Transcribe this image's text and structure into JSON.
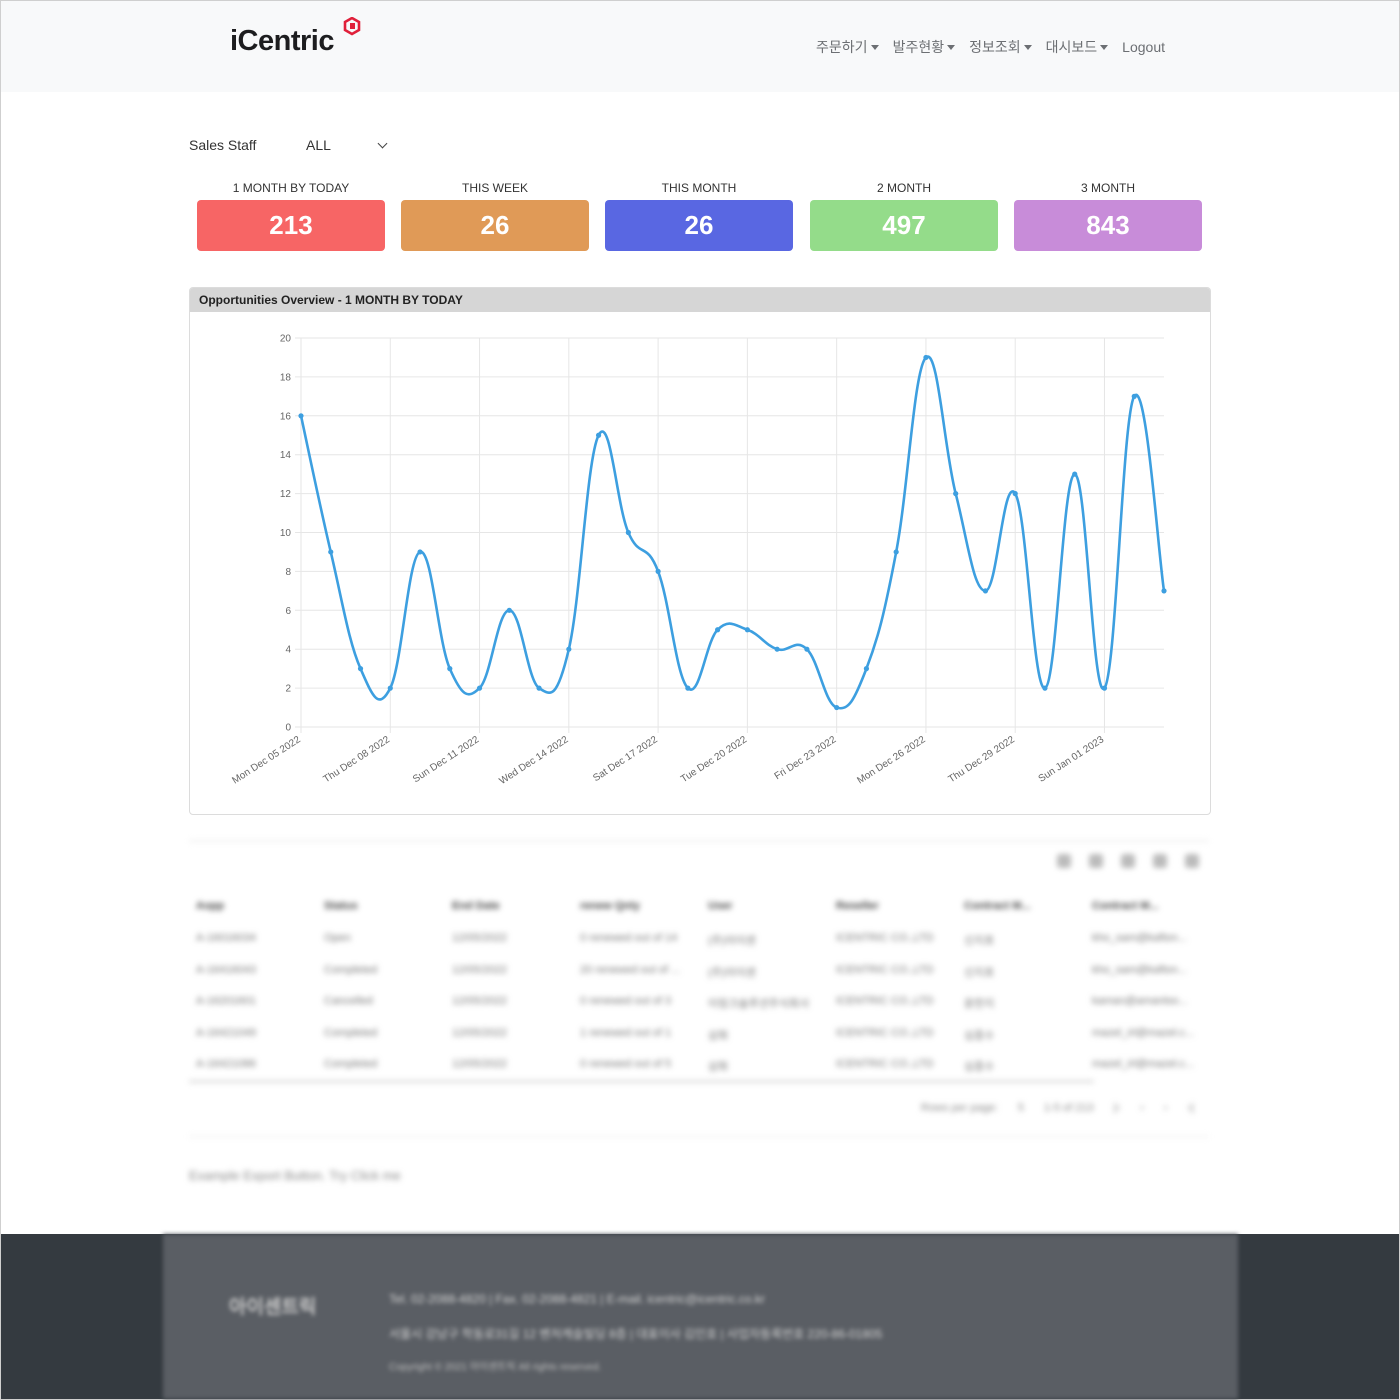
{
  "header": {
    "logo_text": "iCentric",
    "nav": [
      "주문하기",
      "발주현황",
      "정보조회",
      "대시보드"
    ],
    "logout": "Logout"
  },
  "filter": {
    "label": "Sales Staff",
    "value": "ALL"
  },
  "kpis": [
    {
      "title": "1 MONTH BY TODAY",
      "value": "213",
      "color": "#f76565"
    },
    {
      "title": "THIS WEEK",
      "value": "26",
      "color": "#e09a57"
    },
    {
      "title": "THIS MONTH",
      "value": "26",
      "color": "#5967e2"
    },
    {
      "title": "2 MONTH",
      "value": "497",
      "color": "#94dc8a"
    },
    {
      "title": "3 MONTH",
      "value": "843",
      "color": "#c88cd9"
    }
  ],
  "chart_card": {
    "title": "Opportunities Overview - 1 MONTH BY TODAY"
  },
  "chart_data": {
    "type": "line",
    "title": "",
    "xlabel": "",
    "ylabel": "",
    "ylim": [
      0,
      20
    ],
    "yticks": [
      0,
      2,
      4,
      6,
      8,
      10,
      12,
      14,
      16,
      18,
      20
    ],
    "x": [
      "2022-12-05",
      "2022-12-06",
      "2022-12-07",
      "2022-12-08",
      "2022-12-09",
      "2022-12-10",
      "2022-12-11",
      "2022-12-12",
      "2022-12-13",
      "2022-12-14",
      "2022-12-15",
      "2022-12-16",
      "2022-12-17",
      "2022-12-18",
      "2022-12-19",
      "2022-12-20",
      "2022-12-21",
      "2022-12-22",
      "2022-12-23",
      "2022-12-24",
      "2022-12-25",
      "2022-12-26",
      "2022-12-27",
      "2022-12-28",
      "2022-12-29",
      "2022-12-30",
      "2022-12-31",
      "2023-01-01",
      "2023-01-02",
      "2023-01-03"
    ],
    "xtick_labels": [
      "Mon Dec 05 2022",
      "Thu Dec 08 2022",
      "Sun Dec 11 2022",
      "Wed Dec 14 2022",
      "Sat Dec 17 2022",
      "Tue Dec 20 2022",
      "Fri Dec 23 2022",
      "Mon Dec 26 2022",
      "Thu Dec 29 2022",
      "Sun Jan 01 2023"
    ],
    "values": [
      16,
      9,
      3,
      2,
      9,
      3,
      2,
      6,
      2,
      4,
      15,
      10,
      8,
      2,
      5,
      5,
      4,
      4,
      1,
      3,
      9,
      19,
      12,
      7,
      12,
      2,
      13,
      2,
      17,
      7
    ],
    "color": "#3d9fe0",
    "grid": true
  },
  "table": {
    "headers": [
      "Aopp",
      "Status",
      "End Date",
      "renew Qnty",
      "User",
      "Reseller",
      "Contract M...",
      "Contract M..."
    ],
    "rows": [
      [
        "A-16016034",
        "Open",
        "12/05/2022",
        "0 renewed out of 14",
        "(주)아이센",
        "ICENTRIC CO.,LTD",
        "신지호",
        "kho_sam@kafton..."
      ],
      [
        "A-16416043",
        "Completed",
        "12/05/2022",
        "20 renewed out of ...",
        "(주)아이센",
        "ICENTRIC CO.,LTD",
        "신지호",
        "kho_sam@kafton..."
      ],
      [
        "A-16201601",
        "Cancelled",
        "12/05/2022",
        "0 renewed out of 3",
        "이링크솔루션주식회사",
        "ICENTRIC CO.,LTD",
        "윤한지",
        "kaman@amantso..."
      ],
      [
        "A-16421049",
        "Completed",
        "12/05/2022",
        "1 renewed out of 1",
        "삼화",
        "ICENTRIC CO.,LTD",
        "심종수",
        "mazel_irl@mazel.c..."
      ],
      [
        "A-16421086",
        "Completed",
        "12/05/2022",
        "0 renewed out of 5",
        "삼화",
        "ICENTRIC CO.,LTD",
        "심종수",
        "mazel_irl@mazel.c..."
      ]
    ],
    "pager": {
      "rows_label": "Rows per page:",
      "rows_value": "5",
      "range": "1-5 of 213"
    }
  },
  "export_text": "Example Export Button. Try Click me",
  "footer": {
    "brand": "아이센트릭",
    "line1": "Tel. 02-2088-4820  |  Fax. 02-2088-4821  |  E-mail. icentric@icentric.co.kr",
    "line2": "서울시 강남구 학동로31길 12 벤처캐슬빌딩 8층  |  대표이사 김인호  |  사업자등록번호 220-86-01805",
    "copyright": "Copyright © 2021 아이센트릭 All rights reserved."
  }
}
